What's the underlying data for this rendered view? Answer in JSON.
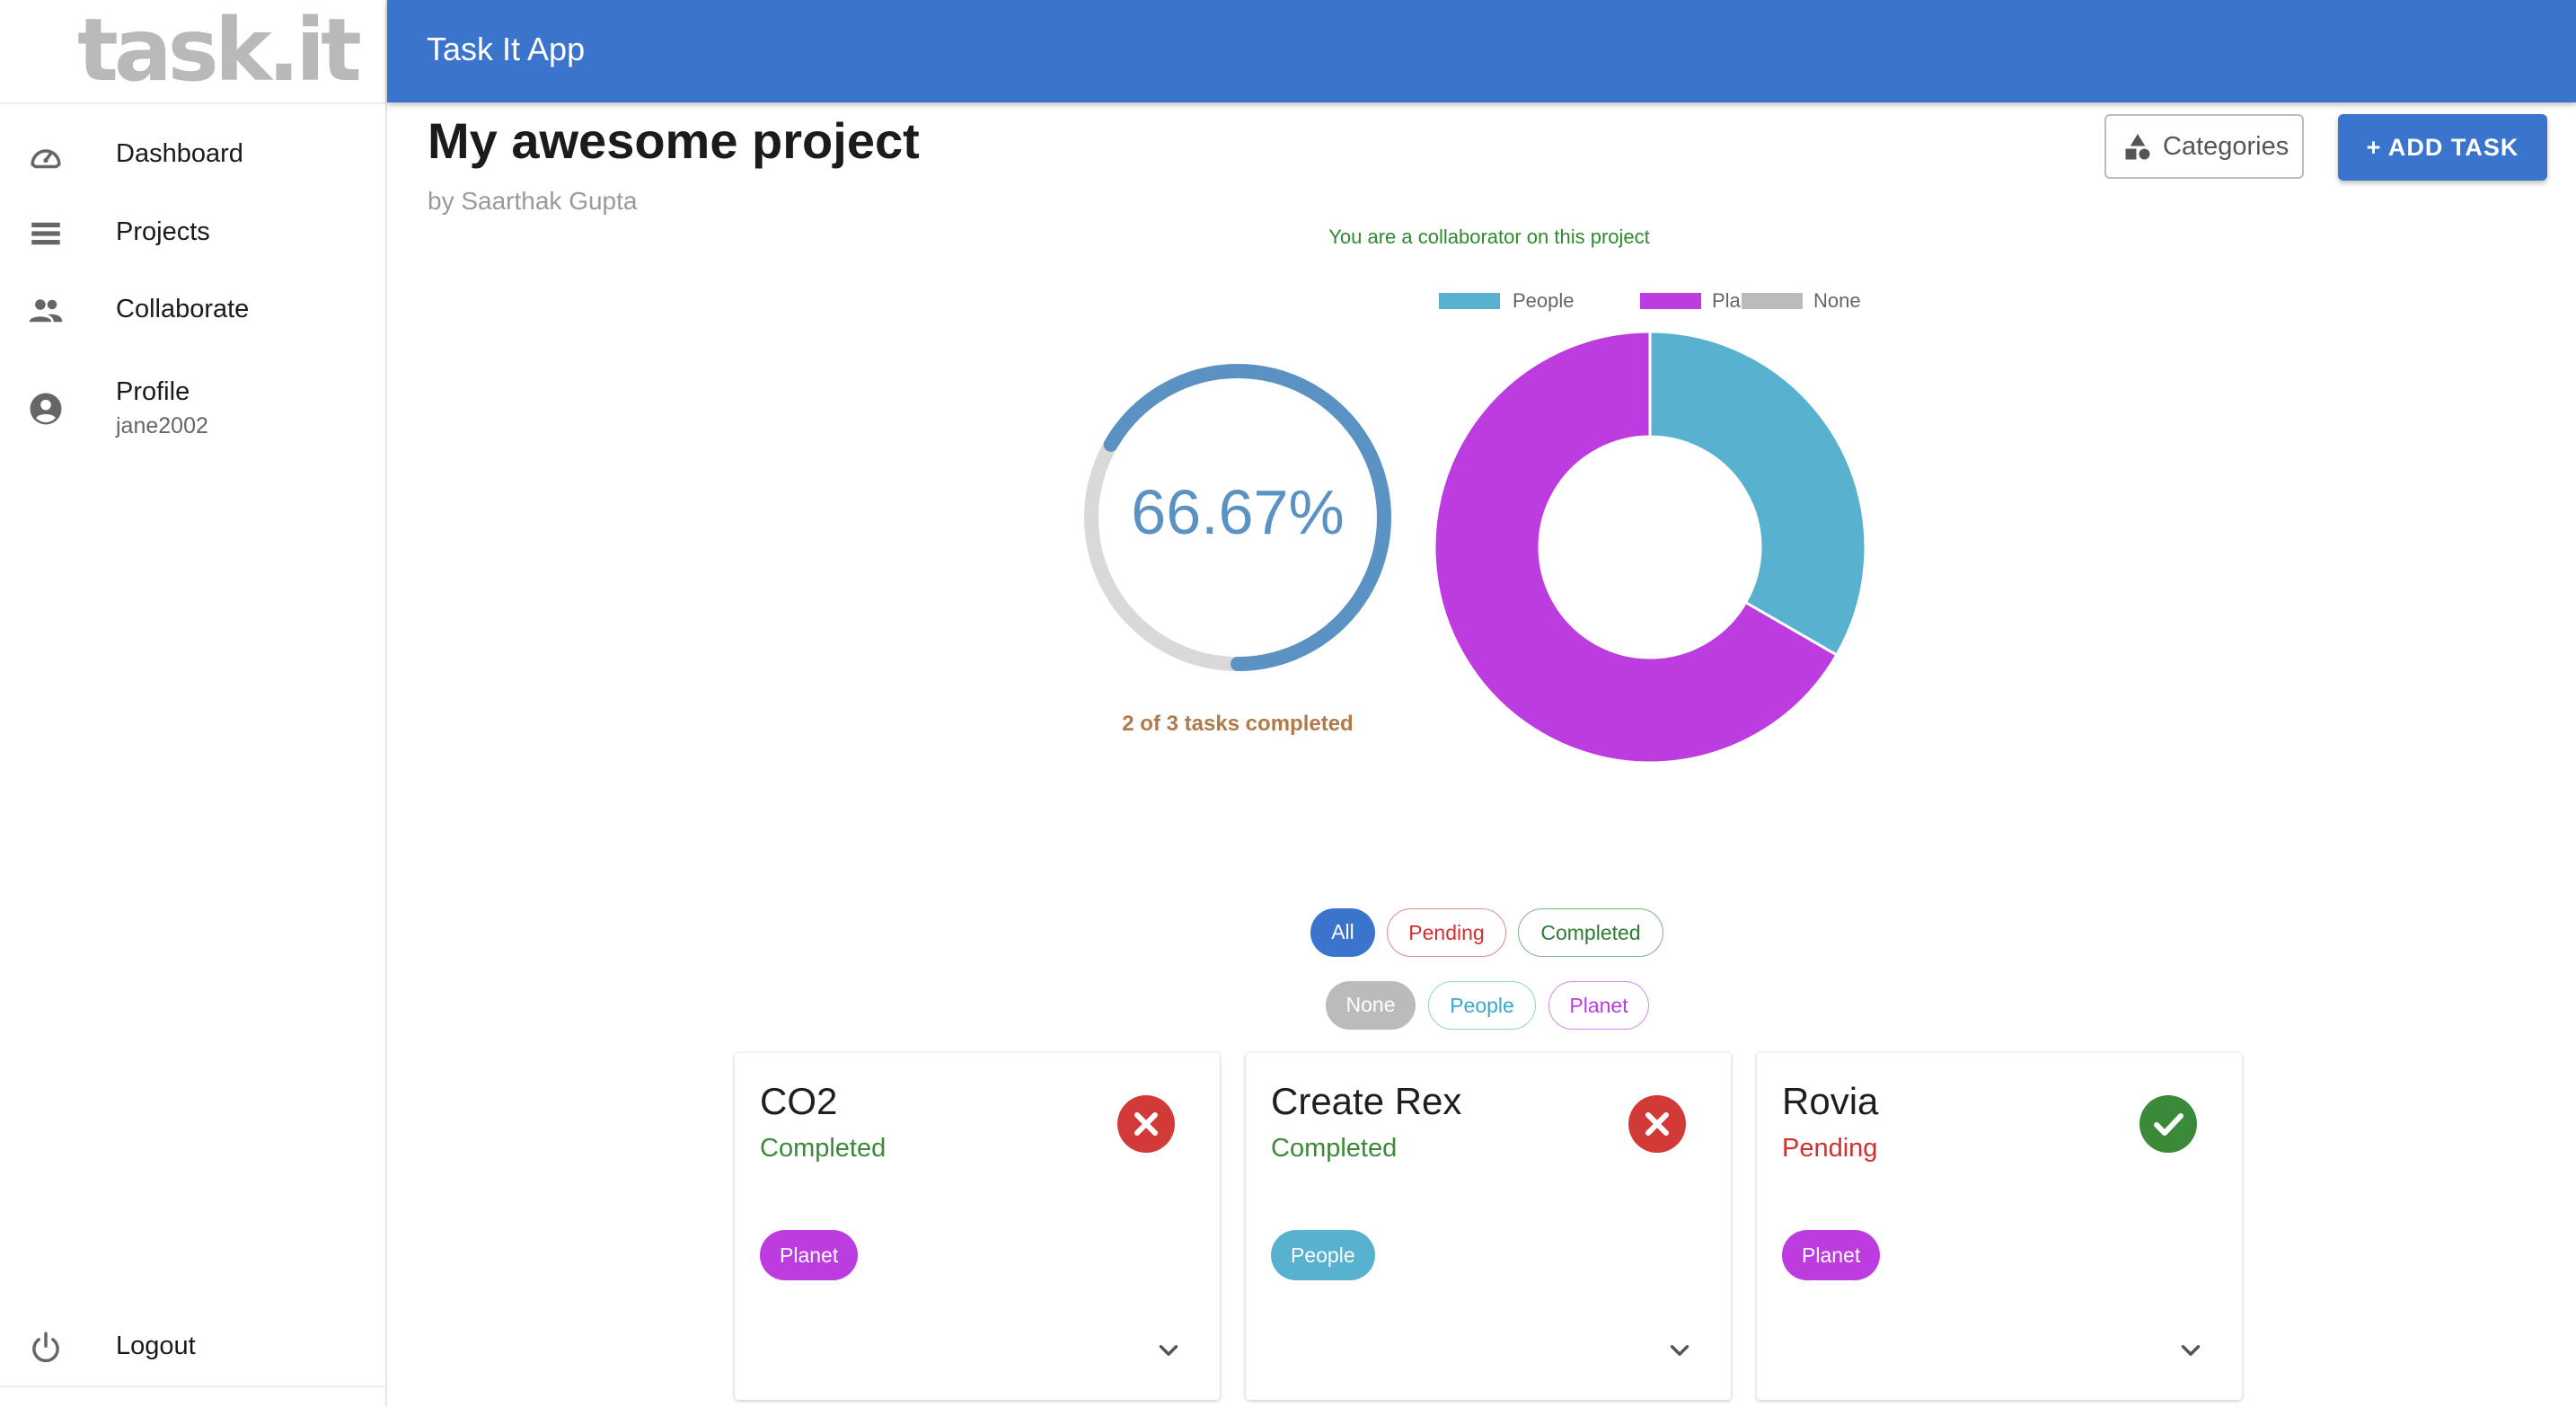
{
  "sidebar": {
    "logo": "task.it",
    "items": [
      {
        "label": "Dashboard",
        "icon": "dashboard-gauge-icon"
      },
      {
        "label": "Projects",
        "icon": "list-icon"
      },
      {
        "label": "Collaborate",
        "icon": "people-icon"
      },
      {
        "label": "Profile",
        "sub": "jane2002",
        "icon": "account-circle-icon"
      }
    ],
    "logout": {
      "label": "Logout",
      "icon": "power-icon"
    }
  },
  "appbar": {
    "title": "Task It App"
  },
  "project": {
    "title": "My awesome project",
    "author": "by Saarthak Gupta",
    "collab_note": "You are a collaborator on this project"
  },
  "actions": {
    "categories_label": "Categories",
    "add_task_label": "+ ADD TASK"
  },
  "progress": {
    "percent_label": "66.67%",
    "fraction": 0.6667,
    "caption": "2 of 3 tasks completed"
  },
  "colors": {
    "people": "#58b1cf",
    "planet": "#bc3ce0",
    "none": "#bbbbbb",
    "accent": "#3a74cd",
    "completed": "#3a8a3a",
    "pending": "#d32f2f"
  },
  "chart_data": {
    "type": "pie",
    "style": "donut",
    "categories": [
      "People",
      "Planet",
      "None"
    ],
    "values": [
      1,
      2,
      0
    ],
    "colors": [
      "#58b1cf",
      "#bc3ce0",
      "#bbbbbb"
    ],
    "legend": "top"
  },
  "filters": {
    "status": [
      {
        "label": "All",
        "active": true
      },
      {
        "label": "Pending",
        "active": false
      },
      {
        "label": "Completed",
        "active": false
      }
    ],
    "category": [
      {
        "label": "None",
        "active": true
      },
      {
        "label": "People",
        "active": false
      },
      {
        "label": "Planet",
        "active": false
      }
    ]
  },
  "tasks": [
    {
      "title": "CO2",
      "status": "Completed",
      "tag": "Planet",
      "action_icon": "close-circle-icon"
    },
    {
      "title": "Create Rex",
      "status": "Completed",
      "tag": "People",
      "action_icon": "close-circle-icon"
    },
    {
      "title": "Rovia",
      "status": "Pending",
      "tag": "Planet",
      "action_icon": "check-circle-icon"
    }
  ]
}
